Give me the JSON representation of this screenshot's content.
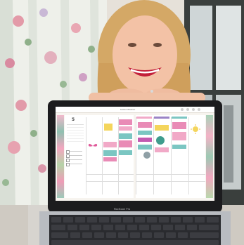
{
  "laptop": {
    "brand_label": "MacBook Pro"
  },
  "planner": {
    "title": "Lesson Planner",
    "month_number": "5",
    "colors": {
      "pink": "#e98bb6",
      "teal": "#7bc6c2",
      "yellow": "#f4d55c",
      "purple": "#9a83c6",
      "paper": "#f7f4ef"
    }
  }
}
